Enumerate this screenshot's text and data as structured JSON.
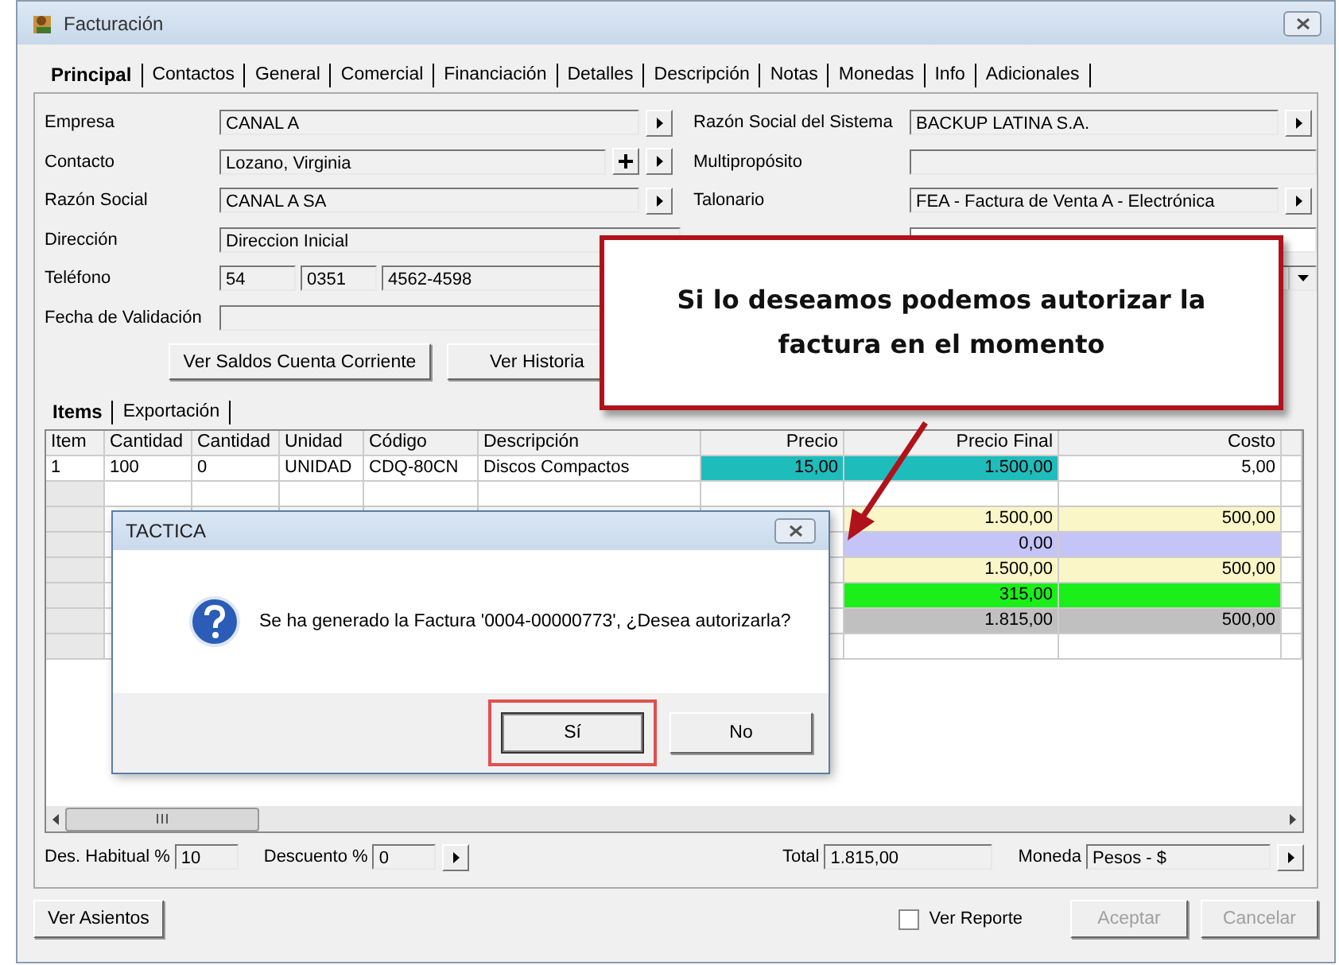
{
  "window": {
    "title": "Facturación"
  },
  "tabs": [
    {
      "label": "Principal",
      "selected": true
    },
    {
      "label": "Contactos",
      "selected": false
    },
    {
      "label": "General",
      "selected": false
    },
    {
      "label": "Comercial",
      "selected": false
    },
    {
      "label": "Financiación",
      "selected": false
    },
    {
      "label": "Detalles",
      "selected": false
    },
    {
      "label": "Descripción",
      "selected": false
    },
    {
      "label": "Notas",
      "selected": false
    },
    {
      "label": "Monedas",
      "selected": false
    },
    {
      "label": "Info",
      "selected": false
    },
    {
      "label": "Adicionales",
      "selected": false
    }
  ],
  "form_left": [
    {
      "label": "Empresa",
      "kind": "lookup",
      "value": "CANAL A"
    },
    {
      "label": "Contacto",
      "kind": "lookup_add",
      "value": "Lozano, Virginia"
    },
    {
      "label": "Razón Social",
      "kind": "lookup",
      "value": "CANAL A SA"
    },
    {
      "label": "Dirección",
      "kind": "text",
      "value": "Direccion Inicial"
    },
    {
      "label": "Teléfono",
      "kind": "phone",
      "parts": [
        "54",
        "0351",
        "4562-4598"
      ]
    },
    {
      "label": "Fecha de Validación",
      "kind": "text"
    }
  ],
  "form_right": [
    {
      "label": "Razón Social del Sistema",
      "kind": "lookup",
      "value": "BACKUP LATINA S.A."
    },
    {
      "label": "Multipropósito",
      "kind": "text"
    },
    {
      "label": "Talonario",
      "kind": "lookup",
      "value": "FEA - Factura de Venta A - Electrónica"
    },
    {
      "kind": "blank"
    },
    {
      "kind": "dropdown"
    }
  ],
  "action_buttons": [
    "Ver Saldos Cuenta Corriente",
    "Ver Historia"
  ],
  "sub_tabs": [
    {
      "label": "Items",
      "selected": true
    },
    {
      "label": "Exportación",
      "selected": false
    }
  ],
  "table": {
    "columns": [
      "Item",
      "Cantidad",
      "Cantidad",
      "Unidad",
      "Código",
      "Descripción",
      "Precio",
      "Precio Final",
      "Costo"
    ],
    "rows": [
      {
        "cells": [
          {
            "text": "1"
          },
          {
            "text": "100"
          },
          {
            "text": "0"
          },
          {
            "text": "UNIDAD"
          },
          {
            "text": "CDQ-80CN"
          },
          {
            "text": "Discos Compactos"
          },
          {
            "text": "15,00",
            "color": "#1fbcbc"
          },
          {
            "text": "1.500,00",
            "color": "#1fbcbc"
          },
          {
            "text": "5,00"
          }
        ]
      }
    ],
    "summary_rows": [
      {
        "precio_final": "1.500,00",
        "costo": "500,00",
        "color": "#fbf6c8"
      },
      {
        "precio_final": "0,00",
        "color": "#c4c4f8"
      },
      {
        "precio_final": "1.500,00",
        "costo": "500,00",
        "color": "#fbf6c8"
      },
      {
        "precio_final": "315,00",
        "color": "#1aef1a"
      },
      {
        "precio_final": "1.815,00",
        "costo": "500,00",
        "color": "#c0c0c0"
      }
    ]
  },
  "footer": {
    "des_habitual": {
      "label": "Des. Habitual %",
      "value": "10"
    },
    "descuento": {
      "label": "Descuento %",
      "value": "0"
    },
    "total": {
      "label": "Total",
      "value": "1.815,00"
    },
    "moneda": {
      "label": "Moneda",
      "value": "Pesos - $"
    }
  },
  "bottom": {
    "ver_asientos": "Ver Asientos",
    "ver_reporte": {
      "label": "Ver Reporte",
      "checked": false
    },
    "buttons": [
      {
        "label": "Aceptar",
        "disabled": true
      },
      {
        "label": "Cancelar",
        "disabled": true
      }
    ]
  },
  "dialog": {
    "title": "TACTICA",
    "message": "Se ha generado la Factura '0004-00000773', ¿Desea autorizarla?",
    "buttons": [
      {
        "label": "Sí",
        "focused": true
      },
      {
        "label": "No",
        "focused": false
      }
    ]
  },
  "callout": {
    "text": "Si lo deseamos podemos autorizar la factura en el momento"
  }
}
